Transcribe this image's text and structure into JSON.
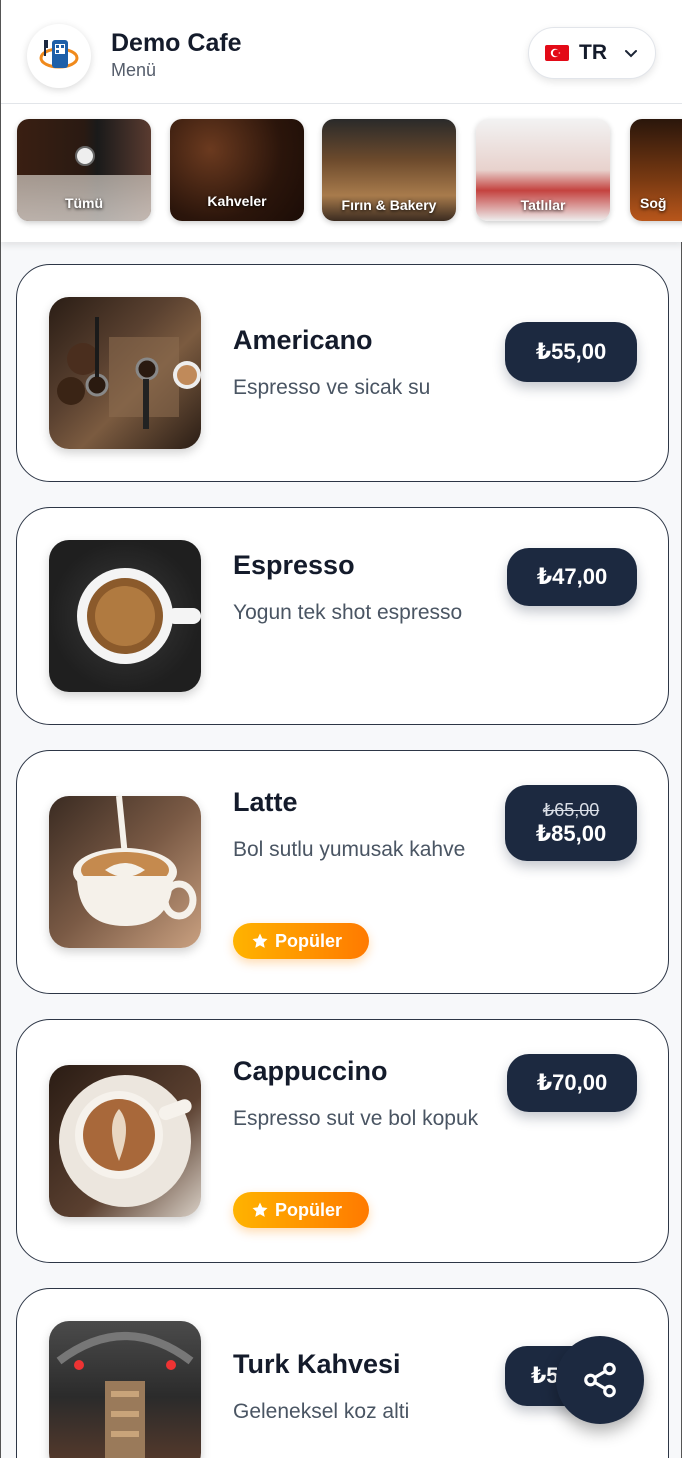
{
  "header": {
    "title": "Demo Cafe",
    "subtitle": "Menü",
    "language": "TR",
    "logo_icon": "menu-qr-logo-icon"
  },
  "categories": [
    {
      "label": "Tümü"
    },
    {
      "label": "Kahveler"
    },
    {
      "label": "Fırın & Bakery"
    },
    {
      "label": "Tatlılar"
    },
    {
      "label": "Soğ"
    }
  ],
  "products": [
    {
      "name": "Americano",
      "desc": "Espresso ve sicak su",
      "price": "₺55,00"
    },
    {
      "name": "Espresso",
      "desc": "Yogun tek shot espresso",
      "price": "₺47,00"
    },
    {
      "name": "Latte",
      "desc": "Bol sutlu yumusak kahve",
      "old_price": "₺65,00",
      "price": "₺85,00",
      "badge": "Popüler"
    },
    {
      "name": "Cappuccino",
      "desc": "Espresso sut ve bol kopuk",
      "price": "₺70,00",
      "badge": "Popüler"
    },
    {
      "name": "Turk Kahvesi",
      "desc": "Geleneksel koz alti",
      "price": "₺5"
    }
  ],
  "colors": {
    "primary": "#1c2940",
    "badge_start": "#ffb300",
    "badge_end": "#ff7a00"
  },
  "share_icon": "share-icon"
}
